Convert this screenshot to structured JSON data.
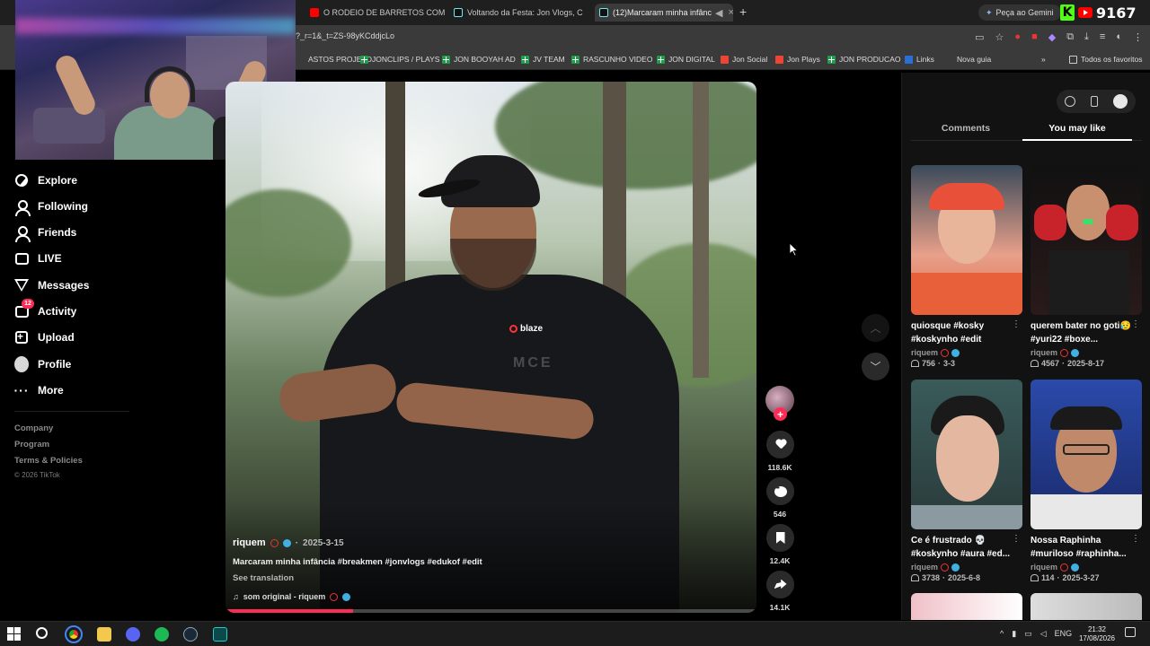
{
  "browser": {
    "tabs": [
      {
        "title": "O RODEIO DE BARRETOS COM",
        "favicon": "youtube-icon",
        "active": false
      },
      {
        "title": "Voltando da Festa: Jon Vlogs, C",
        "favicon": "tiktok-icon",
        "active": false
      },
      {
        "title": "(12)Marcaram minha infânc",
        "favicon": "tiktok-icon",
        "active": true
      }
    ],
    "gemini_label": "Peça ao Gemini",
    "viewer_count": "9167",
    "url": "?_r=1&_t=ZS-98yKCddjcLo",
    "bookmarks": [
      {
        "label": "ASTOS PROJETO",
        "icon": "plain"
      },
      {
        "label": "JONCLIPS / PLAYS",
        "icon": "sheets"
      },
      {
        "label": "JON BOOYAH AD",
        "icon": "sheets"
      },
      {
        "label": "JV TEAM",
        "icon": "sheets"
      },
      {
        "label": "RASCUNHO VIDEO",
        "icon": "sheets"
      },
      {
        "label": "JON DIGITAL",
        "icon": "sheets"
      },
      {
        "label": "Jon Social",
        "icon": "red"
      },
      {
        "label": "Jon Plays",
        "icon": "red"
      },
      {
        "label": "JON PRODUCAO",
        "icon": "sheets"
      },
      {
        "label": "Links",
        "icon": "blue"
      },
      {
        "label": "Nova guia",
        "icon": "plain"
      }
    ],
    "bookmarks_more": "»",
    "all_favorites": "Todos os favoritos"
  },
  "nav": {
    "items": [
      {
        "label": "Explore",
        "icon": "compass-icon"
      },
      {
        "label": "Following",
        "icon": "following-icon"
      },
      {
        "label": "Friends",
        "icon": "friends-icon"
      },
      {
        "label": "LIVE",
        "icon": "live-icon"
      },
      {
        "label": "Messages",
        "icon": "messages-icon"
      },
      {
        "label": "Activity",
        "icon": "activity-icon",
        "badge": "12"
      },
      {
        "label": "Upload",
        "icon": "upload-icon"
      },
      {
        "label": "Profile",
        "icon": "avatar-icon"
      },
      {
        "label": "More",
        "icon": "more-icon"
      }
    ],
    "footer": [
      "Company",
      "Program",
      "Terms & Policies"
    ],
    "copyright": "© 2026 TikTok"
  },
  "video": {
    "author": "riquem",
    "date": "2025-3-15",
    "caption": "Marcaram minha infância #breakmen #jonvlogs #edukof #edit",
    "see_translation": "See translation",
    "sound": "som original - riquem",
    "shirt_logo": "blaze",
    "watermark": "MCE",
    "progress": 0.24,
    "likes": "118.6K",
    "comments": "546",
    "saves": "12.4K",
    "shares": "14.1K"
  },
  "panel": {
    "tabs": [
      "Comments",
      "You may like"
    ],
    "active_tab": "You may like",
    "cards": [
      {
        "title": "quiosque #kosky #koskynho #edit",
        "author": "riquem",
        "likes": "756",
        "date": "3-3"
      },
      {
        "title": "querem bater no goti😥 #yuri22 #boxe...",
        "author": "riquem",
        "likes": "4567",
        "date": "2025-8-17"
      },
      {
        "title": "Ce é frustrado 💀 #koskynho #aura #ed...",
        "author": "riquem",
        "likes": "3738",
        "date": "2025-6-8"
      },
      {
        "title": "Nossa Raphinha #muriloso #raphinha...",
        "author": "riquem",
        "likes": "114",
        "date": "2025-3-27"
      }
    ]
  },
  "taskbar": {
    "tray": [
      "^",
      "ENG"
    ],
    "time": "21:32",
    "date": "17/08/2026"
  },
  "colors": {
    "accent": "#fe2c55",
    "background": "#000000",
    "panel": "#121212"
  }
}
